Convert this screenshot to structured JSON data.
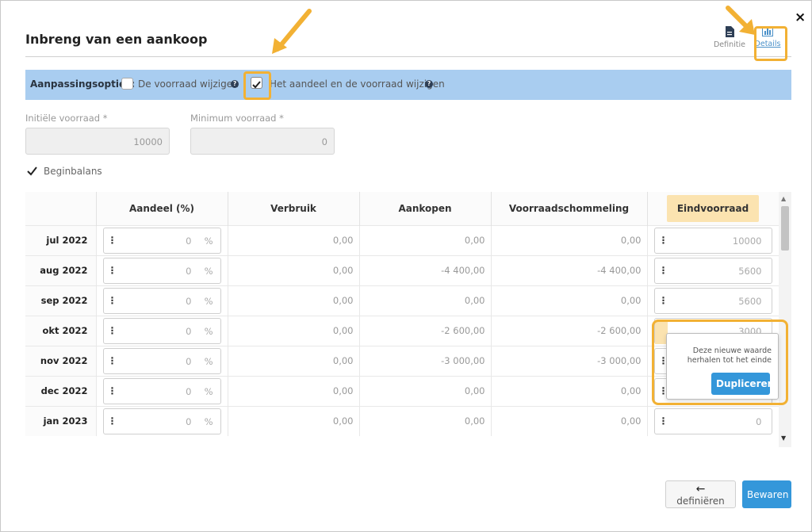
{
  "dialog": {
    "title": "Inbreng van een aankoop",
    "close": "×",
    "tabs": [
      {
        "label": "Definitie",
        "icon": "document-icon"
      },
      {
        "label": "Details",
        "icon": "bar-chart-icon",
        "active": true
      }
    ]
  },
  "options": {
    "title": "Aanpassingsopties:",
    "option1": {
      "label": "De voorraad wijzigen",
      "checked": false
    },
    "option2": {
      "label": "Het aandeel en de voorraad wijzigen",
      "checked": true
    }
  },
  "fields": {
    "initial": {
      "label": "Initiële voorraad *",
      "value": "10000"
    },
    "minimum": {
      "label": "Minimum voorraad *",
      "value": "0"
    }
  },
  "beginbalans": {
    "label": "Beginbalans",
    "checked": true
  },
  "table": {
    "headers": [
      "",
      "Aandeel (%)",
      "Verbruik",
      "Aankopen",
      "Voorraadschommeling",
      "Eindvoorraad"
    ],
    "unit": "%",
    "rows": [
      {
        "month": "jul 2022",
        "aandeel": "0",
        "verbruik": "0,00",
        "aankopen": "0,00",
        "schommeling": "0,00",
        "eind": "10000"
      },
      {
        "month": "aug 2022",
        "aandeel": "0",
        "verbruik": "0,00",
        "aankopen": "-4 400,00",
        "schommeling": "-4 400,00",
        "eind": "5600"
      },
      {
        "month": "sep 2022",
        "aandeel": "0",
        "verbruik": "0,00",
        "aankopen": "0,00",
        "schommeling": "0,00",
        "eind": "5600"
      },
      {
        "month": "okt 2022",
        "aandeel": "0",
        "verbruik": "0,00",
        "aankopen": "-2 600,00",
        "schommeling": "-2 600,00",
        "eind": "3000"
      },
      {
        "month": "nov 2022",
        "aandeel": "0",
        "verbruik": "0,00",
        "aankopen": "-3 000,00",
        "schommeling": "-3 000,00",
        "eind": ""
      },
      {
        "month": "dec 2022",
        "aandeel": "0",
        "verbruik": "0,00",
        "aankopen": "0,00",
        "schommeling": "0,00",
        "eind": ""
      },
      {
        "month": "jan 2023",
        "aandeel": "0",
        "verbruik": "0,00",
        "aankopen": "0,00",
        "schommeling": "0,00",
        "eind": "0"
      }
    ]
  },
  "popover": {
    "text": "Deze nieuwe waarde herhalen tot het einde",
    "button": "Dupliceren"
  },
  "footer": {
    "back": "definiëren",
    "save": "Bewaren"
  },
  "colors": {
    "accent": "#3497da",
    "highlight": "#f2b134",
    "options_bar": "#a9cdf0",
    "eind_header": "#fbe3b0"
  }
}
